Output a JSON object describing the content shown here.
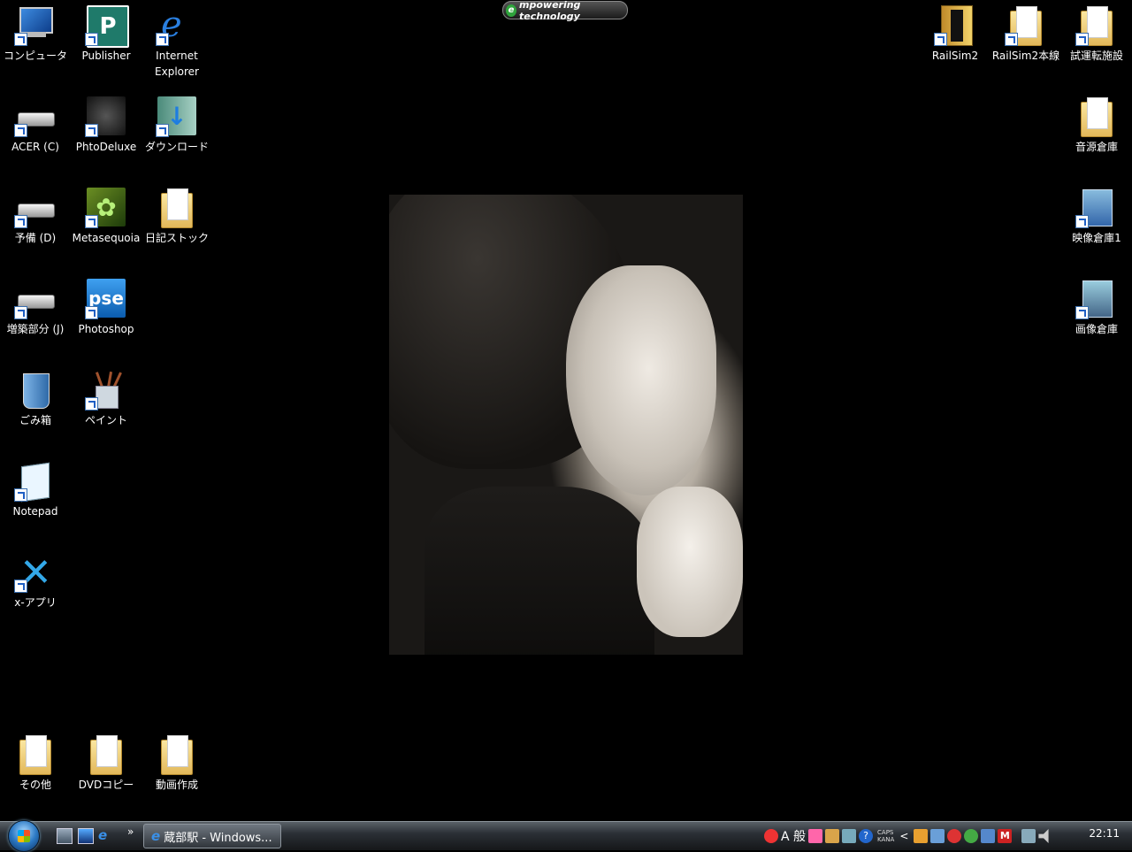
{
  "gadget": {
    "text": "mpowering technology",
    "badge": "e"
  },
  "desktop_icons": {
    "computer": "コンピュータ",
    "publisher": "Publisher",
    "ie": "Internet\nExplorer",
    "acer_c": "ACER (C)",
    "phtodeluxe": "PhtoDeluxe",
    "download": "ダウンロード",
    "yobi_d": "予備 (D)",
    "metasequoia": "Metasequoia",
    "diary": "日記ストック",
    "zouchiku_j": "増築部分 (J)",
    "photoshop": "Photoshop",
    "photoshop_tile": "pse",
    "trash": "ごみ箱",
    "paint": "ペイント",
    "notepad": "Notepad",
    "x_app": "x-アプリ",
    "sonota": "その他",
    "dvd_copy": "DVDコピー",
    "douga": "動画作成",
    "railsim2": "RailSim2",
    "railsim2_main": "RailSim2本線",
    "shiunten": "試運転施設",
    "ongen": "音源倉庫",
    "eizou": "映像倉庫1",
    "gazou": "画像倉庫"
  },
  "taskbar": {
    "quicklaunch_more": "»",
    "task_label": "蔵部駅 - Windows...",
    "ime_mode": "A 般",
    "caps": "CAPS",
    "kana": "KANA",
    "expand": "<",
    "clock": "22:11"
  },
  "colors": {
    "accent": "#2c79c4",
    "taskbar": "#2b3036"
  }
}
